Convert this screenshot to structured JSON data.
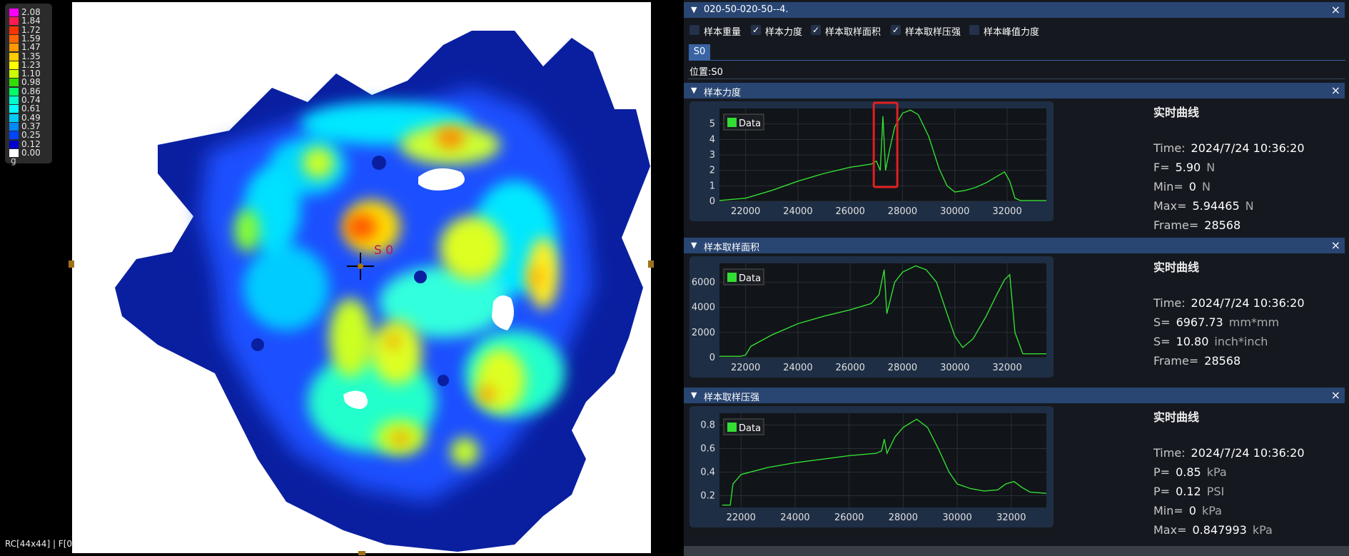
{
  "colorbar": {
    "unit": "g",
    "entries": [
      {
        "label": "2.08",
        "color": "#ff00ff"
      },
      {
        "label": "1.84",
        "color": "#ff1a50"
      },
      {
        "label": "1.72",
        "color": "#ff3300"
      },
      {
        "label": "1.59",
        "color": "#ff6600"
      },
      {
        "label": "1.47",
        "color": "#ff9900"
      },
      {
        "label": "1.35",
        "color": "#ffcc00"
      },
      {
        "label": "1.23",
        "color": "#ffff00"
      },
      {
        "label": "1.10",
        "color": "#ccff00"
      },
      {
        "label": "0.98",
        "color": "#33dd00"
      },
      {
        "label": "0.86",
        "color": "#00ff66"
      },
      {
        "label": "0.74",
        "color": "#00ffcc"
      },
      {
        "label": "0.61",
        "color": "#00ffff"
      },
      {
        "label": "0.49",
        "color": "#00ccff"
      },
      {
        "label": "0.37",
        "color": "#0088ff"
      },
      {
        "label": "0.25",
        "color": "#0044ff"
      },
      {
        "label": "0.12",
        "color": "#0000cc"
      },
      {
        "label": "0.00",
        "color": "#ffffff"
      }
    ]
  },
  "heatmap": {
    "marker_label": "S 0"
  },
  "status_text": "RC[44x44] | F[0.",
  "panel": {
    "title": "020-50-020-50--4.",
    "checkboxes": [
      {
        "label": "样本重量",
        "checked": false
      },
      {
        "label": "样本力度",
        "checked": true
      },
      {
        "label": "样本取样面积",
        "checked": true
      },
      {
        "label": "样本取样压强",
        "checked": true
      },
      {
        "label": "样本峰值力度",
        "checked": false
      }
    ],
    "tab": "S0",
    "position": "位置:S0"
  },
  "sections": [
    {
      "title": "样本力度",
      "legend": "Data",
      "info_title": "实时曲线",
      "info": [
        {
          "k": "Time:",
          "v": "2024/7/24 10:36:20",
          "u": ""
        },
        {
          "k": "F=",
          "v": "5.90",
          "u": "N"
        },
        {
          "k": "Min=",
          "v": "0",
          "u": "N"
        },
        {
          "k": "Max=",
          "v": "5.94465",
          "u": "N"
        },
        {
          "k": "Frame=",
          "v": "28568",
          "u": ""
        }
      ]
    },
    {
      "title": "样本取样面积",
      "legend": "Data",
      "info_title": "实时曲线",
      "info": [
        {
          "k": "Time:",
          "v": "2024/7/24 10:36:20",
          "u": ""
        },
        {
          "k": "S=",
          "v": "6967.73",
          "u": "mm*mm"
        },
        {
          "k": "S=",
          "v": "10.80",
          "u": "inch*inch"
        },
        {
          "k": "Frame=",
          "v": "28568",
          "u": ""
        }
      ]
    },
    {
      "title": "样本取样压强",
      "legend": "Data",
      "info_title": "实时曲线",
      "info": [
        {
          "k": "Time:",
          "v": "2024/7/24 10:36:20",
          "u": ""
        },
        {
          "k": "P=",
          "v": "0.85",
          "u": "kPa"
        },
        {
          "k": "P=",
          "v": "0.12",
          "u": "PSI"
        },
        {
          "k": "Min=",
          "v": "0",
          "u": "kPa"
        },
        {
          "k": "Max=",
          "v": "0.847993",
          "u": "kPa"
        }
      ]
    }
  ],
  "chart_data": [
    {
      "type": "line",
      "xticks": [
        "22000",
        "24000",
        "26000",
        "28000",
        "30000",
        "32000"
      ],
      "yticks": [
        "0",
        "1",
        "2",
        "3",
        "4",
        "5"
      ],
      "xlim": [
        21000,
        33500
      ],
      "ylim": [
        0,
        6
      ],
      "grid": true,
      "legend": "top-left",
      "series": [
        {
          "name": "Data",
          "color": "#33dd33",
          "x": [
            21000,
            22000,
            23000,
            24000,
            25000,
            26000,
            26800,
            27000,
            27150,
            27250,
            27350,
            27500,
            27700,
            28000,
            28300,
            28600,
            29000,
            29400,
            29700,
            30000,
            30400,
            30800,
            31200,
            31600,
            31900,
            32100,
            32300,
            32500,
            33500
          ],
          "y": [
            0.05,
            0.2,
            0.7,
            1.3,
            1.8,
            2.2,
            2.4,
            2.6,
            2.0,
            5.5,
            2.0,
            3.3,
            4.8,
            5.7,
            5.9,
            5.6,
            4.2,
            2.1,
            1.0,
            0.6,
            0.7,
            0.9,
            1.2,
            1.6,
            1.9,
            1.3,
            0.2,
            0.05,
            0.05
          ]
        }
      ],
      "annotation": {
        "type": "highlight-box",
        "x_from": 26900,
        "x_to": 27800
      }
    },
    {
      "type": "line",
      "xticks": [
        "22000",
        "24000",
        "26000",
        "28000",
        "30000",
        "32000"
      ],
      "yticks": [
        "0",
        "2000",
        "4000",
        "6000"
      ],
      "xlim": [
        21000,
        33500
      ],
      "ylim": [
        0,
        7500
      ],
      "grid": true,
      "legend": "top-left",
      "series": [
        {
          "name": "Data",
          "color": "#33dd33",
          "x": [
            21000,
            21800,
            22000,
            22200,
            23000,
            24000,
            25000,
            26000,
            26800,
            27100,
            27300,
            27400,
            27700,
            28000,
            28500,
            28900,
            29300,
            29700,
            30000,
            30300,
            30700,
            31200,
            31600,
            31900,
            32100,
            32300,
            32600,
            33500
          ],
          "y": [
            100,
            100,
            200,
            900,
            1800,
            2700,
            3300,
            3800,
            4300,
            5000,
            7000,
            3500,
            6000,
            6800,
            7300,
            7000,
            6000,
            3500,
            1700,
            800,
            1500,
            3300,
            5000,
            6200,
            6600,
            2000,
            300,
            300
          ]
        }
      ]
    },
    {
      "type": "line",
      "xticks": [
        "22000",
        "24000",
        "26000",
        "28000",
        "30000",
        "32000"
      ],
      "yticks": [
        "0.2",
        "0.4",
        "0.6",
        "0.8"
      ],
      "xlim": [
        21200,
        33300
      ],
      "ylim": [
        0.1,
        0.9
      ],
      "grid": true,
      "legend": "top-left",
      "series": [
        {
          "name": "Data",
          "color": "#33dd33",
          "x": [
            21300,
            21600,
            21700,
            22000,
            23000,
            24000,
            25000,
            26000,
            27000,
            27200,
            27300,
            27400,
            27700,
            28000,
            28500,
            28900,
            29300,
            29700,
            30000,
            30500,
            31000,
            31500,
            31800,
            32100,
            32400,
            32700,
            33300
          ],
          "y": [
            0.12,
            0.12,
            0.3,
            0.38,
            0.44,
            0.48,
            0.51,
            0.54,
            0.56,
            0.58,
            0.68,
            0.56,
            0.7,
            0.78,
            0.85,
            0.78,
            0.6,
            0.4,
            0.3,
            0.26,
            0.24,
            0.25,
            0.3,
            0.32,
            0.27,
            0.23,
            0.22
          ]
        }
      ]
    }
  ]
}
